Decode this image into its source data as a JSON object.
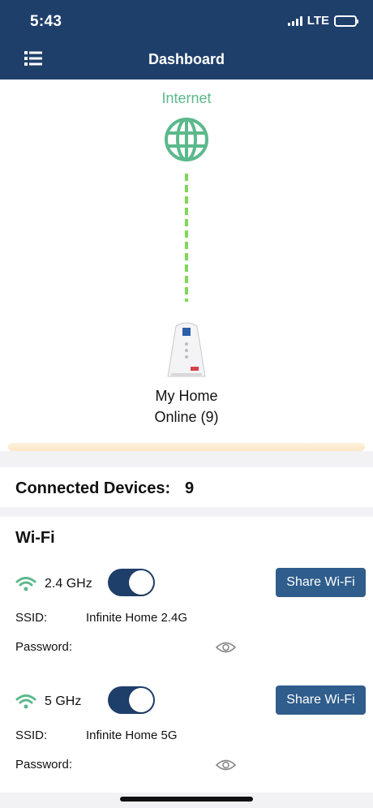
{
  "status_bar": {
    "time": "5:43",
    "network": "LTE"
  },
  "header": {
    "title": "Dashboard",
    "menu_icon": "list-icon",
    "color": "#1f3f6b"
  },
  "topology": {
    "internet_label": "Internet",
    "globe_icon": "globe-icon",
    "router_name": "My Home",
    "router_status": "Online (9)"
  },
  "devices": {
    "label": "Connected Devices:",
    "count": "9"
  },
  "wifi": {
    "title": "Wi-Fi",
    "bands": [
      {
        "name": "2.4 GHz",
        "enabled": true,
        "share_label": "Share Wi-Fi",
        "ssid_label": "SSID:",
        "ssid": "Infinite Home 2.4G",
        "password_label": "Password:"
      },
      {
        "name": "5 GHz",
        "enabled": true,
        "share_label": "Share Wi-Fi",
        "ssid_label": "SSID:",
        "ssid": "Infinite Home 5G",
        "password_label": "Password:"
      }
    ]
  },
  "colors": {
    "accent": "#2f5d8c",
    "internet_green": "#5bb98c",
    "link_green": "#7ed957"
  }
}
